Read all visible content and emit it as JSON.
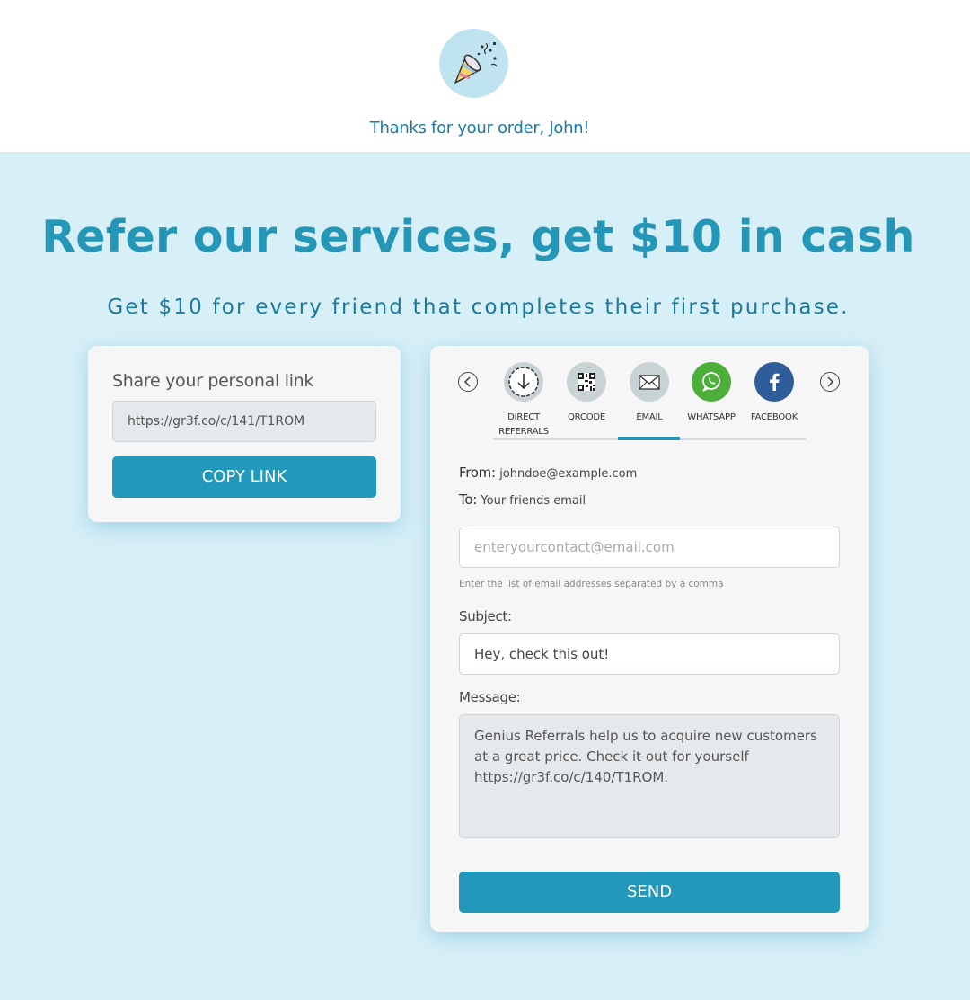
{
  "header": {
    "logo_icon": "party-popper-icon",
    "thanks_text": "Thanks for your order, John!"
  },
  "hero": {
    "headline": "Refer our services, get $10 in cash",
    "subline": "Get $10 for every friend that completes their first purchase."
  },
  "share_link": {
    "title": "Share your personal link",
    "url": "https://gr3f.co/c/141/T1ROM",
    "copy_label": "COPY LINK"
  },
  "channels": {
    "active": "email",
    "tabs": [
      {
        "id": "direct",
        "label_line1": "DIRECT",
        "label_line2": "REFERRALS",
        "icon": "download-icon"
      },
      {
        "id": "qr",
        "label_line1": "QRCODE",
        "icon": "qr-code-icon"
      },
      {
        "id": "email",
        "label_line1": "EMAIL",
        "icon": "envelope-icon"
      },
      {
        "id": "whatsapp",
        "label_line1": "WHATSAPP",
        "icon": "whatsapp-icon"
      },
      {
        "id": "facebook",
        "label_line1": "FACEBOOK",
        "icon": "facebook-icon"
      }
    ]
  },
  "email_form": {
    "from_label": "From:",
    "from_value": "johndoe@example.com",
    "to_label": "To:",
    "to_value": "Your friends email",
    "email_placeholder": "enteryourcontact@email.com",
    "hint": "Enter the list of email addresses separated by a comma",
    "subject_label": "Subject:",
    "subject_value": "Hey, check this out!",
    "message_label": "Message:",
    "message_value": "Genius Referrals help us to acquire new customers at a great price. Check it out for yourself https://gr3f.co/c/140/T1ROM.",
    "send_label": "SEND"
  },
  "colors": {
    "accent": "#2299ba",
    "band_background": "#d7eff7",
    "headline": "#2497b8",
    "whatsapp": "#4caf3a",
    "facebook": "#2f5d9a"
  }
}
